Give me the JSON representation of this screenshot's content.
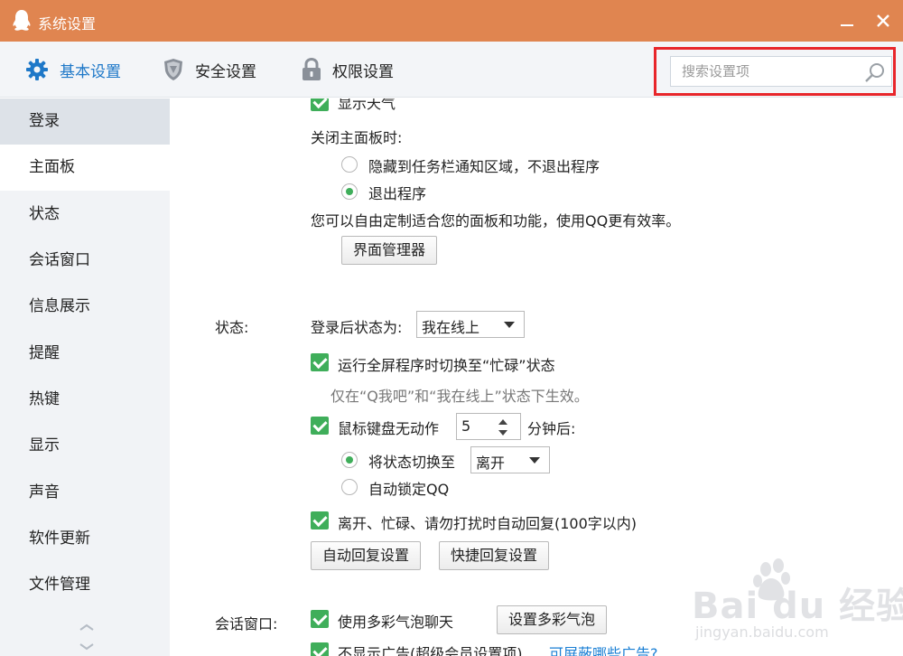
{
  "window": {
    "title": "系统设置"
  },
  "tabs": [
    {
      "label": "基本设置",
      "icon": "gear-icon",
      "active": true
    },
    {
      "label": "安全设置",
      "icon": "shield-icon",
      "active": false
    },
    {
      "label": "权限设置",
      "icon": "lock-icon",
      "active": false
    }
  ],
  "search": {
    "placeholder": "搜索设置项",
    "value": ""
  },
  "sidebar": {
    "items": [
      {
        "label": "登录"
      },
      {
        "label": "主面板"
      },
      {
        "label": "状态"
      },
      {
        "label": "会话窗口"
      },
      {
        "label": "信息展示"
      },
      {
        "label": "提醒"
      },
      {
        "label": "热键"
      },
      {
        "label": "显示"
      },
      {
        "label": "声音"
      },
      {
        "label": "软件更新"
      },
      {
        "label": "文件管理"
      }
    ]
  },
  "main_panel": {
    "show_weather": "显示天气",
    "close_label": "关闭主面板时:",
    "option_hide": "隐藏到任务栏通知区域，不退出程序",
    "option_exit": "退出程序",
    "customize_text": "您可以自由定制适合您的面板和功能，使用QQ更有效率。",
    "ui_manager_button": "界面管理器"
  },
  "status": {
    "section_label": "状态:",
    "login_status_label": "登录后状态为:",
    "login_status_value": "我在线上",
    "fullscreen_busy": "运行全屏程序时切换至“忙碌”状态",
    "fullscreen_hint": "仅在“Q我吧”和“我在线上”状态下生效。",
    "idle_label": "鼠标键盘无动作",
    "idle_minutes": "5",
    "idle_suffix": "分钟后:",
    "switch_to_label": "将状态切换至",
    "switch_to_value": "离开",
    "auto_lock": "自动锁定QQ",
    "auto_reply": "离开、忙碌、请勿打扰时自动回复(100字以内)",
    "auto_reply_settings_button": "自动回复设置",
    "quick_reply_settings_button": "快捷回复设置"
  },
  "chat_window": {
    "section_label": "会话窗口:",
    "colorful_bubble": "使用多彩气泡聊天",
    "set_bubble_button": "设置多彩气泡",
    "no_ads": "不显示广告(超级会员设置项)",
    "which_ads_link": "可屏蔽哪些广告?"
  },
  "watermark": {
    "brand": "Bai du 经验",
    "url": "jingyan.baidu.com"
  },
  "colors": {
    "titlebar": "#e08550",
    "accent": "#1e78c8",
    "check_green": "#3fae5a",
    "highlight_red": "#e8262b",
    "link": "#1a7fd4"
  }
}
